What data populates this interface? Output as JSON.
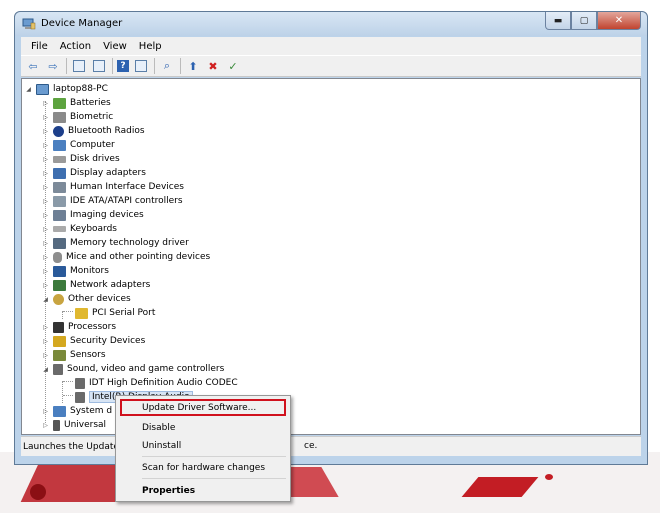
{
  "window": {
    "title": "Device Manager"
  },
  "menu": [
    "File",
    "Action",
    "View",
    "Help"
  ],
  "toolbar_icons": [
    "back-icon",
    "forward-icon",
    "properties-icon",
    "show-hidden-icon",
    "help-icon",
    "view-icon",
    "scan-icon",
    "update-driver-icon",
    "uninstall-icon",
    "enable-icon"
  ],
  "tree": {
    "root": "laptop88-PC",
    "categories": [
      "Batteries",
      "Biometric",
      "Bluetooth Radios",
      "Computer",
      "Disk drives",
      "Display adapters",
      "Human Interface Devices",
      "IDE ATA/ATAPI controllers",
      "Imaging devices",
      "Keyboards",
      "Memory technology driver",
      "Mice and other pointing devices",
      "Monitors",
      "Network adapters",
      "Other devices",
      "Processors",
      "Security Devices",
      "Sensors",
      "Sound, video and game controllers",
      "System d",
      "Universal"
    ],
    "other_devices_child": "PCI Serial Port",
    "sound_children": [
      "IDT High Definition Audio CODEC",
      "Intel(R) Display Audio"
    ]
  },
  "status": {
    "left": "Launches the Update",
    "right": "ce."
  },
  "context_menu": {
    "update": "Update Driver Software...",
    "disable": "Disable",
    "uninstall": "Uninstall",
    "scan": "Scan for hardware changes",
    "properties": "Properties"
  },
  "colors": {
    "highlight_box": "#d0111d",
    "selection": "#d7e4f4"
  }
}
